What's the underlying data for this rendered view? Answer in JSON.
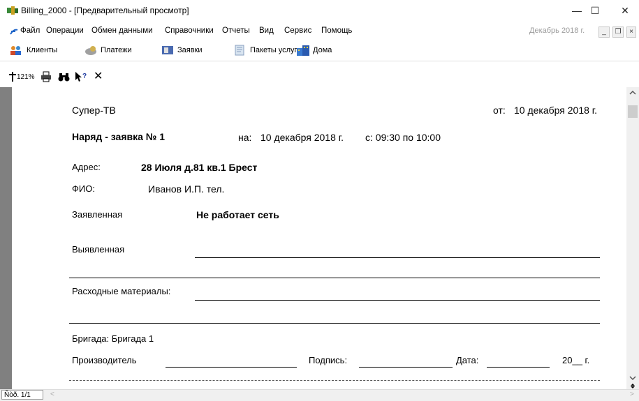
{
  "window": {
    "title": "Billing_2000 - [Предварительный просмотр]",
    "minimize": "—",
    "maximize": "☐",
    "close": "✕"
  },
  "menu": {
    "items": [
      "Файл",
      "Операции",
      "Обмен данными",
      "Справочники",
      "Отчеты",
      "Вид",
      "Сервис",
      "Помощь"
    ],
    "period": "Декабрь 2018 г."
  },
  "toolbar": {
    "clients": "Клиенты",
    "payments": "Платежи",
    "requests": "Заявки",
    "packages": "Пакеты услуг",
    "houses": "Дома"
  },
  "preview_toolbar": {
    "zoom": "121%"
  },
  "document": {
    "company": "Супер-ТВ",
    "date_label": "от:",
    "date": "10 декабря 2018 г.",
    "order_title": "Наряд - заявка № 1",
    "on_label": "на:",
    "on_date": "10 декабря 2018 г.",
    "time": "с: 09:30 по 10:00",
    "address_label": "Адрес:",
    "address": "28 Июля д.81 кв.1  Брест",
    "fio_label": "ФИО:",
    "fio": "Иванов И.П.  тел.",
    "declared_label": "Заявленная",
    "declared": "Не работает сеть",
    "found_label": "Выявленная",
    "materials_label": "Расходные материалы:",
    "brigade": "Бригада: Бригада 1",
    "producer_label": "Производитель",
    "signature_label": "Подпись:",
    "date_sign_label": "Дата:",
    "year_suffix": "20__ г."
  },
  "status": {
    "page": "Ñòð. 1/1"
  },
  "colors": {
    "preview_background": "#808080",
    "accent_blue": "#1e64c8"
  }
}
